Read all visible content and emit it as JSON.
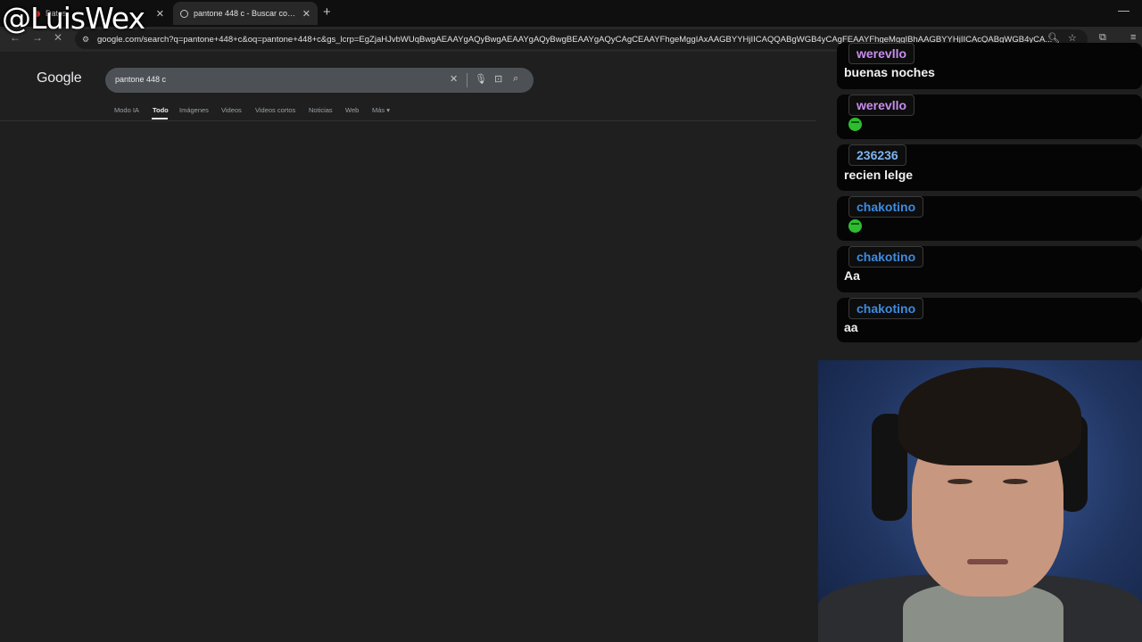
{
  "browser": {
    "tabs": [
      {
        "title": "Datos"
      },
      {
        "title": "pantone 448 c - Buscar con Google"
      }
    ],
    "url": "google.com/search?q=pantone+448+c&oq=pantone+448+c&gs_lcrp=EgZjaHJvbWUqBwgAEAAYgAQyBwgAEAAYgAQyBwgBEAAYgAQyCAgCEAAYFhgeMggIAxAAGBYYHjIICAQQABgWGB4yCAgFEAAYFhgeMggIBhAAGBYYHjIICAcQABgWGB4yCA..."
  },
  "google": {
    "logo": "Google",
    "query": "pantone 448 c",
    "filters": [
      "Modo IA",
      "Todo",
      "Imágenes",
      "Videos",
      "Videos cortos",
      "Noticias",
      "Web",
      "Más"
    ],
    "active_filter": "Todo"
  },
  "chat": {
    "messages": [
      {
        "user": "werevllo",
        "text": "buenas noches",
        "user_color": "#c98ef0"
      },
      {
        "user": "werevllo",
        "emote": "green-emote",
        "user_color": "#c98ef0"
      },
      {
        "user": "236236",
        "text": "recien lelge",
        "user_color": "#7eb4f0"
      },
      {
        "user": "chakotino",
        "emote": "green-emote",
        "user_color": "#3d8be0"
      },
      {
        "user": "chakotino",
        "text": "Aa",
        "user_color": "#3d8be0"
      },
      {
        "user": "chakotino",
        "text": "aa",
        "user_color": "#3d8be0"
      }
    ]
  },
  "watermark": "@LuisWex"
}
